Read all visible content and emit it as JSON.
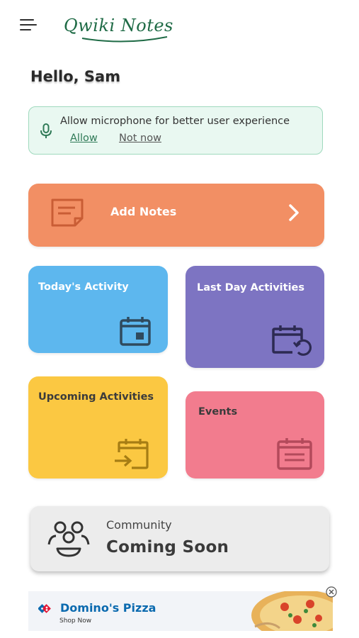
{
  "header": {
    "app_name": "Qwiki Notes",
    "menu_icon": "hamburger-menu-icon"
  },
  "greeting": "Hello, Sam",
  "mic_banner": {
    "message": "Allow microphone for better user experience",
    "allow_label": "Allow",
    "not_now_label": "Not now",
    "icon": "microphone-icon"
  },
  "cards": {
    "add_notes": {
      "label": "Add Notes",
      "color": "#f28f64",
      "icon": "note-icon"
    },
    "today": {
      "label": "Today's Activity",
      "color": "#5db7ee",
      "icon": "calendar-icon"
    },
    "last_day": {
      "label": "Last Day Activities",
      "color": "#7d74c2",
      "icon": "calendar-history-icon"
    },
    "upcoming": {
      "label": "Upcoming Activities",
      "color": "#fbc842",
      "icon": "calendar-arrow-icon"
    },
    "events": {
      "label": "Events",
      "color": "#f27c8e",
      "icon": "calendar-list-icon"
    }
  },
  "community": {
    "title": "Community",
    "status": "Coming Soon",
    "icon": "people-icon"
  },
  "ad": {
    "brand": "Domino's Pizza",
    "cta": "Shop Now",
    "close_icon": "close-icon"
  },
  "colors": {
    "accent_green": "#2f7a57",
    "banner_bg": "#e9f8f1"
  }
}
